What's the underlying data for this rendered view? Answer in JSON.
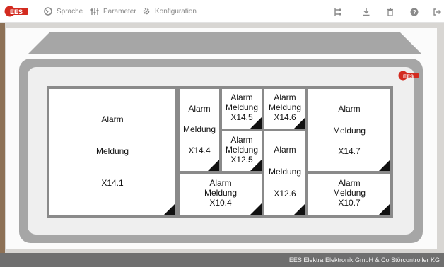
{
  "nav": {
    "items": [
      {
        "label": "Sprache",
        "icon": "globe-icon"
      },
      {
        "label": "Parameter",
        "icon": "sliders-icon"
      },
      {
        "label": "Konfiguration",
        "icon": "gear-icon"
      }
    ],
    "right_icons": [
      "tree-icon",
      "download-icon",
      "trash-icon",
      "help-icon",
      "logout-icon"
    ]
  },
  "panel": {
    "x14_1": {
      "l1": "Alarm",
      "l2": "Meldung",
      "l3": "X14.1"
    },
    "x14_4": {
      "l1": "Alarm",
      "l2": "Meldung",
      "l3": "X14.4"
    },
    "x14_5": {
      "l1": "Alarm",
      "l2": "Meldung",
      "l3": "X14.5"
    },
    "x14_6": {
      "l1": "Alarm",
      "l2": "Meldung",
      "l3": "X14.6"
    },
    "x12_5": {
      "l1": "Alarm",
      "l2": "Meldung",
      "l3": "X12.5"
    },
    "x12_6": {
      "l1": "Alarm",
      "l2": "Meldung",
      "l3": "X12.6"
    },
    "x14_7": {
      "l1": "Alarm",
      "l2": "Meldung",
      "l3": "X14.7"
    },
    "x10_4": {
      "l1": "Alarm",
      "l2": "Meldung",
      "l3": "X10.4"
    },
    "x10_7": {
      "l1": "Alarm",
      "l2": "Meldung",
      "l3": "X10.7"
    }
  },
  "footer": {
    "text": "EES Elektra Elektronik GmbH & Co Störcontroller KG"
  },
  "colors": {
    "brand_red": "#d32a1f",
    "frame_gray": "#a6a6a6",
    "footer_gray": "#6f6f6f"
  }
}
